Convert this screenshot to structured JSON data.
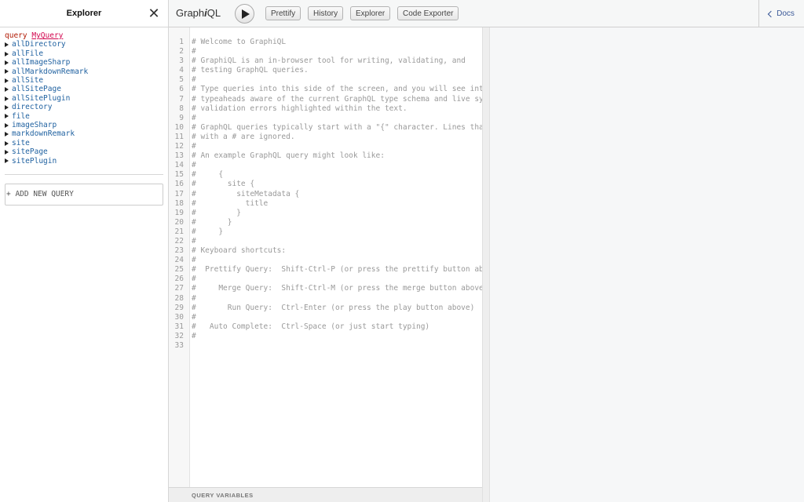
{
  "explorer": {
    "title": "Explorer",
    "close_label": "✕",
    "query_keyword": "query",
    "query_name": "MyQuery",
    "fields": [
      "allDirectory",
      "allFile",
      "allImageSharp",
      "allMarkdownRemark",
      "allSite",
      "allSitePage",
      "allSitePlugin",
      "directory",
      "file",
      "imageSharp",
      "markdownRemark",
      "site",
      "sitePage",
      "sitePlugin"
    ],
    "add_query_label": "+ ADD NEW QUERY"
  },
  "toolbar": {
    "logo_prefix": "Graph",
    "logo_i": "i",
    "logo_suffix": "QL",
    "prettify": "Prettify",
    "history": "History",
    "explorer": "Explorer",
    "code_exporter": "Code Exporter",
    "docs": "Docs"
  },
  "editor": {
    "lines": [
      "# Welcome to GraphiQL",
      "#",
      "# GraphiQL is an in-browser tool for writing, validating, and",
      "# testing GraphQL queries.",
      "#",
      "# Type queries into this side of the screen, and you will see intel",
      "# typeaheads aware of the current GraphQL type schema and live synt",
      "# validation errors highlighted within the text.",
      "#",
      "# GraphQL queries typically start with a \"{\" character. Lines that",
      "# with a # are ignored.",
      "#",
      "# An example GraphQL query might look like:",
      "#",
      "#     {",
      "#       site {",
      "#         siteMetadata {",
      "#           title",
      "#         }",
      "#       }",
      "#     }",
      "#",
      "# Keyboard shortcuts:",
      "#",
      "#  Prettify Query:  Shift-Ctrl-P (or press the prettify button abov",
      "#",
      "#     Merge Query:  Shift-Ctrl-M (or press the merge button above)",
      "#",
      "#       Run Query:  Ctrl-Enter (or press the play button above)",
      "#",
      "#   Auto Complete:  Ctrl-Space (or just start typing)",
      "#",
      ""
    ],
    "variables_label": "QUERY VARIABLES"
  }
}
